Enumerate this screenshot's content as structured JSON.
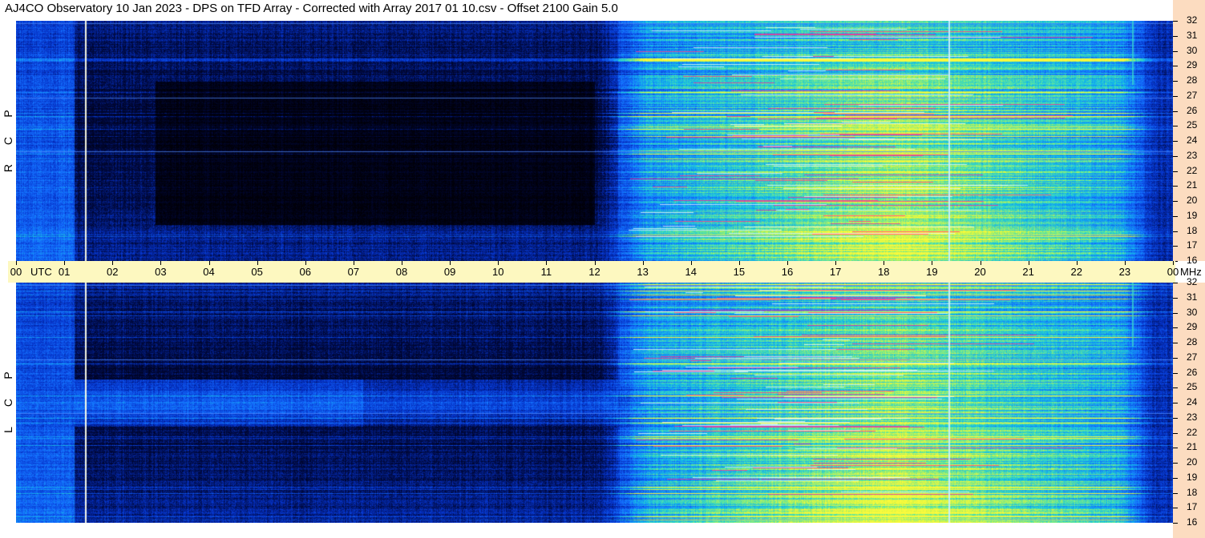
{
  "title": "AJ4CO Observatory  10 Jan 2023  -  DPS on TFD Array  -  Corrected with Array 2017 01 10.csv  -  Offset 2100  Gain 5.0",
  "panels": [
    {
      "id": "rcp",
      "letters": [
        "R",
        "C",
        "P"
      ]
    },
    {
      "id": "lcp",
      "letters": [
        "L",
        "C",
        "P"
      ]
    }
  ],
  "time_axis": {
    "labels": [
      "00",
      "01",
      "02",
      "03",
      "04",
      "05",
      "06",
      "07",
      "08",
      "09",
      "10",
      "11",
      "12",
      "13",
      "14",
      "15",
      "16",
      "17",
      "18",
      "19",
      "20",
      "21",
      "22",
      "23",
      "00"
    ],
    "start_unit": "UTC",
    "end_unit": "MHz"
  },
  "freq_axis": {
    "labels": [
      "32",
      "31",
      "30",
      "29",
      "28",
      "27",
      "26",
      "25",
      "24",
      "23",
      "22",
      "21",
      "20",
      "19",
      "18",
      "17",
      "16"
    ]
  },
  "colors": {
    "time_axis_bg": "#fdf8c0",
    "freq_axis_bg": "#fcdcc0",
    "spectrum_low": "#000010",
    "spectrum_mid": "#0a4aff",
    "spectrum_high": "#f0f040",
    "burst": "#ff3090"
  }
}
